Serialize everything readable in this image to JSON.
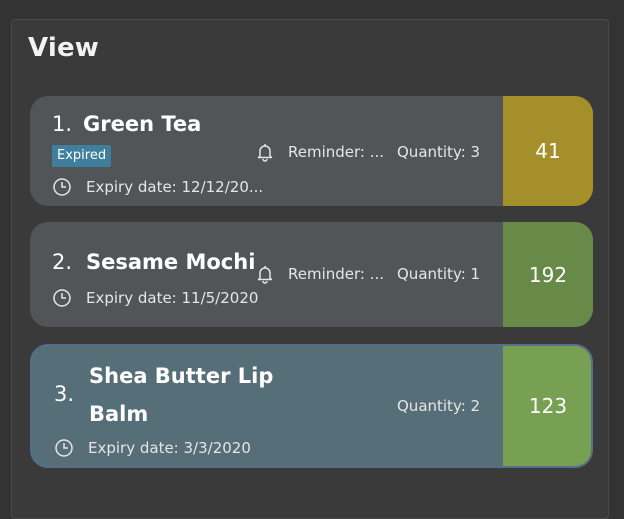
{
  "panel": {
    "title": "View"
  },
  "cards": [
    {
      "index": "1.",
      "name": "Green Tea",
      "badge": "Expired",
      "reminder": "Reminder: ...",
      "quantity": "Quantity: 3",
      "expiry": "Expiry date: 12/12/20...",
      "number": "41",
      "number_color": "#a58f2b"
    },
    {
      "index": "2.",
      "name": "Sesame Mochi",
      "reminder": "Reminder: ...",
      "quantity": "Quantity: 1",
      "expiry": "Expiry date: 11/5/2020",
      "number": "192",
      "number_color": "#678a48"
    },
    {
      "index": "3.",
      "name_line1": "Shea Butter Lip",
      "name_line2": "Balm",
      "quantity": "Quantity: 2",
      "expiry": "Expiry date: 3/3/2020",
      "number": "123",
      "number_color": "#78a053"
    }
  ],
  "icons": {
    "expiry": "clock-icon",
    "reminder": "bell-icon"
  }
}
